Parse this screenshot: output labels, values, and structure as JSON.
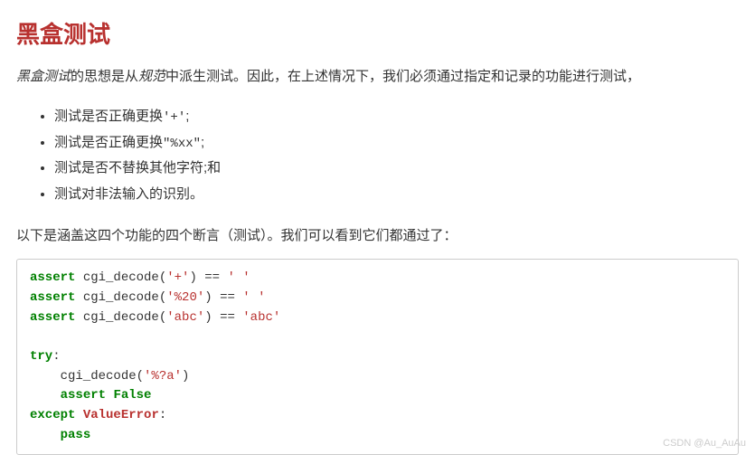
{
  "heading": "黑盒测试",
  "intro": {
    "em1": "黑盒测试",
    "t1": "的思想是从",
    "em2": "规范",
    "t2": "中派生测试。因此，在上述情况下，我们必须通过指定和记录的功能进行测试，"
  },
  "list": {
    "item1": {
      "pre": "测试是否正确更换",
      "code": "'+'",
      "post": ";"
    },
    "item2": {
      "pre": "测试是否正确更换",
      "code": "\"%xx\"",
      "post": ";"
    },
    "item3": "测试是否不替换其他字符;和",
    "item4": "测试对非法输入的识别。"
  },
  "followup": "以下是涵盖这四个功能的四个断言（测试）。我们可以看到它们都通过了：",
  "code": {
    "l1": {
      "kw": "assert",
      "fn": " cgi_decode(",
      "arg": "'+'",
      "mid": ") == ",
      "res": "' '"
    },
    "l2": {
      "kw": "assert",
      "fn": " cgi_decode(",
      "arg": "'%20'",
      "mid": ") == ",
      "res": "' '"
    },
    "l3": {
      "kw": "assert",
      "fn": " cgi_decode(",
      "arg": "'abc'",
      "mid": ") == ",
      "res": "'abc'"
    },
    "l5": {
      "kw": "try",
      "colon": ":"
    },
    "l6": {
      "indent": "    cgi_decode(",
      "arg": "'%?a'",
      "close": ")"
    },
    "l7": {
      "indent": "    ",
      "kw": "assert",
      "sp": " ",
      "val": "False"
    },
    "l8": {
      "kw": "except",
      "sp": " ",
      "exc": "ValueError",
      "colon": ":"
    },
    "l9": {
      "indent": "    ",
      "kw": "pass"
    }
  },
  "watermark": "CSDN @Au_AuAu"
}
